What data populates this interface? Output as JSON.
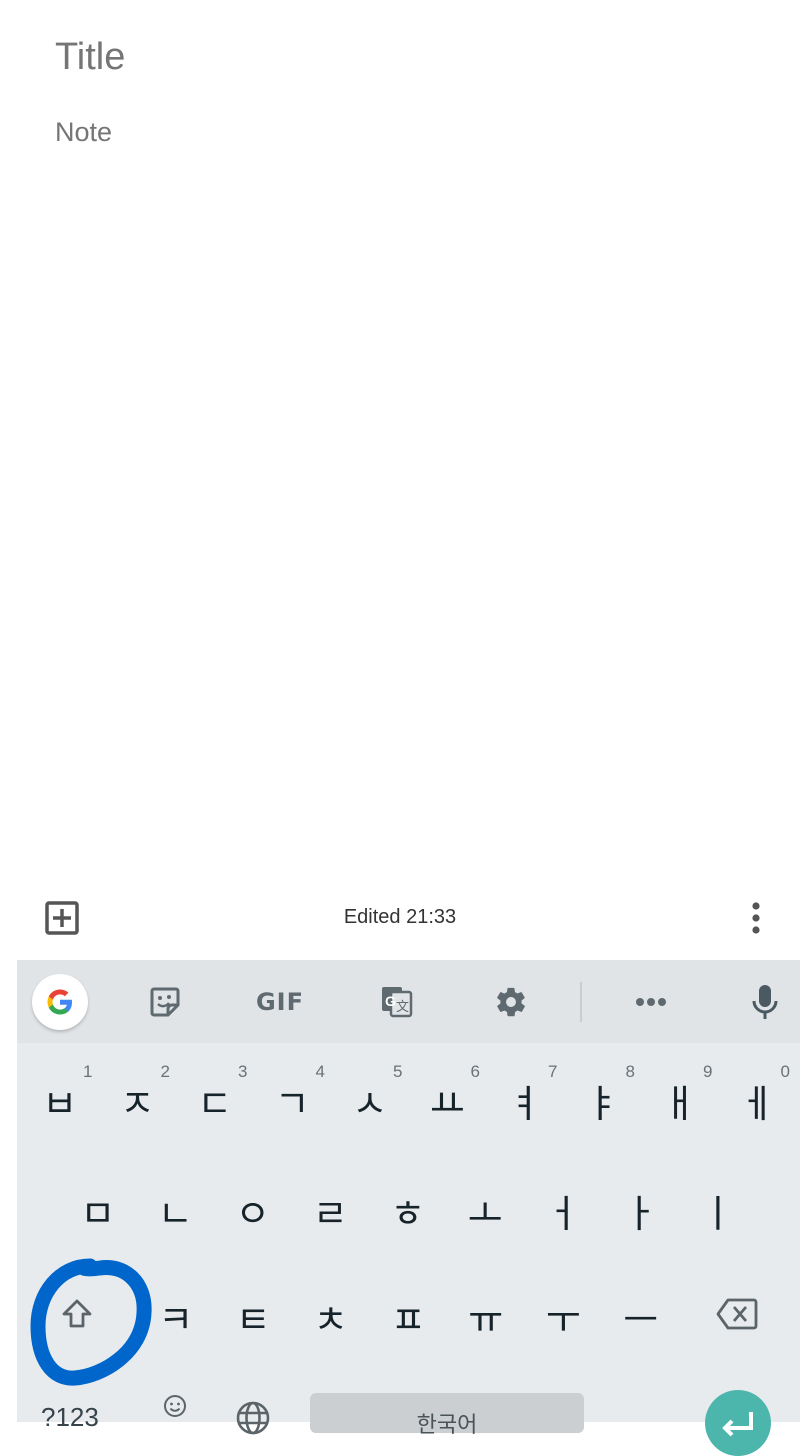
{
  "note": {
    "title_placeholder": "Title",
    "note_placeholder": "Note"
  },
  "bottom_bar": {
    "add_icon": "add-box-icon",
    "edited_label": "Edited 21:33",
    "more_icon": "more-vert-icon"
  },
  "keyboard": {
    "toolbar": {
      "google_icon": "google-g-icon",
      "sticker_icon": "sticker-icon",
      "gif_label": "GIF",
      "translate_icon": "translate-icon",
      "settings_icon": "gear-icon",
      "more_icon": "more-horiz-icon",
      "mic_icon": "mic-icon"
    },
    "row1": [
      {
        "char": "ㅂ",
        "hint": "1"
      },
      {
        "char": "ㅈ",
        "hint": "2"
      },
      {
        "char": "ㄷ",
        "hint": "3"
      },
      {
        "char": "ㄱ",
        "hint": "4"
      },
      {
        "char": "ㅅ",
        "hint": "5"
      },
      {
        "char": "ㅛ",
        "hint": "6"
      },
      {
        "char": "ㅕ",
        "hint": "7"
      },
      {
        "char": "ㅑ",
        "hint": "8"
      },
      {
        "char": "ㅐ",
        "hint": "9"
      },
      {
        "char": "ㅔ",
        "hint": "0"
      }
    ],
    "row2": [
      "ㅁ",
      "ㄴ",
      "ㅇ",
      "ㄹ",
      "ㅎ",
      "ㅗ",
      "ㅓ",
      "ㅏ",
      "ㅣ"
    ],
    "row3": [
      "ㅋ",
      "ㅌ",
      "ㅊ",
      "ㅍ",
      "ㅠ",
      "ㅜ",
      "ㅡ"
    ],
    "shift_icon": "shift-icon",
    "backspace_icon": "backspace-icon",
    "symbols_label": "?123",
    "emoji_icon": "emoji-icon",
    "globe_icon": "globe-icon",
    "space_label": "한국어",
    "enter_icon": "enter-icon"
  },
  "annotation": {
    "color": "#0066cc",
    "target": "shift-key"
  },
  "colors": {
    "keyboard_bg": "#e8ebee",
    "toolbar_bg": "#e1e4e7",
    "enter_accent": "#4db6ac",
    "placeholder": "#b0b0b0"
  }
}
